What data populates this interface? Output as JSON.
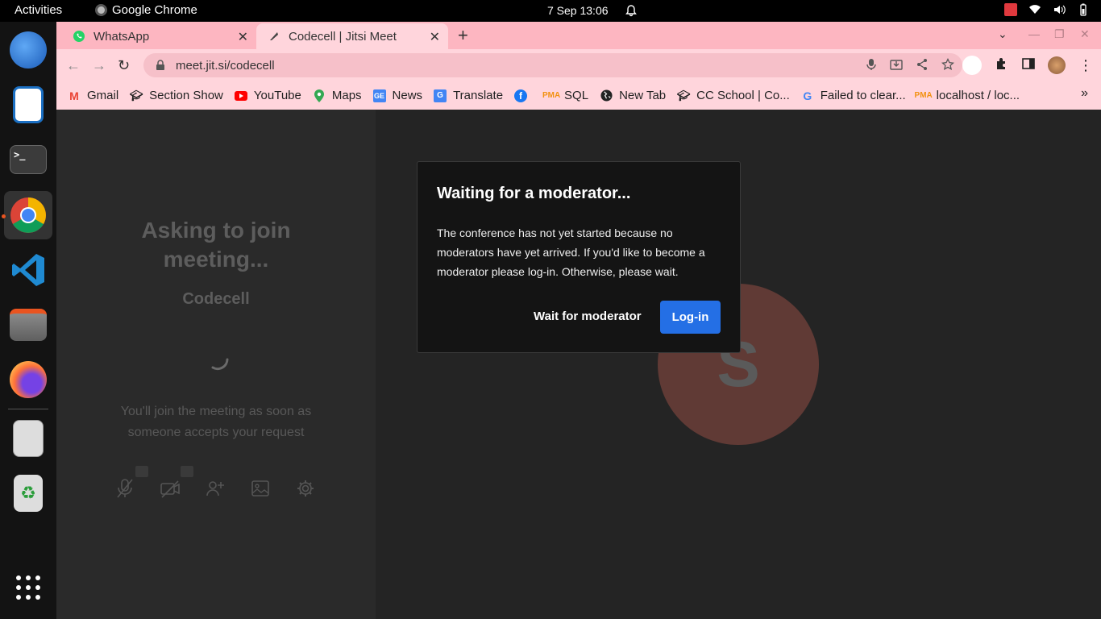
{
  "topbar": {
    "activities": "Activities",
    "app": "Google Chrome",
    "clock": "7 Sep  13:06"
  },
  "tabs": [
    {
      "title": "WhatsApp"
    },
    {
      "title": "Codecell | Jitsi Meet"
    }
  ],
  "address": {
    "url": "meet.jit.si/codecell"
  },
  "bookmarks": [
    {
      "label": "Gmail"
    },
    {
      "label": "Section Show"
    },
    {
      "label": "YouTube"
    },
    {
      "label": "Maps"
    },
    {
      "label": "News"
    },
    {
      "label": "Translate"
    },
    {
      "label": ""
    },
    {
      "label": "SQL"
    },
    {
      "label": "New Tab"
    },
    {
      "label": "CC School | Co..."
    },
    {
      "label": "Failed to clear..."
    },
    {
      "label": "localhost / loc..."
    }
  ],
  "prejoin": {
    "heading": "Asking to join meeting...",
    "room": "Codecell",
    "message": "You'll join the meeting as soon as someone accepts your request"
  },
  "avatar": {
    "initial": "S"
  },
  "dialog": {
    "title": "Waiting for a moderator...",
    "body": "The conference has not yet started because no moderators have yet arrived. If you'd like to become a moderator please log-in. Otherwise, please wait.",
    "wait_label": "Wait for moderator",
    "login_label": "Log-in"
  }
}
